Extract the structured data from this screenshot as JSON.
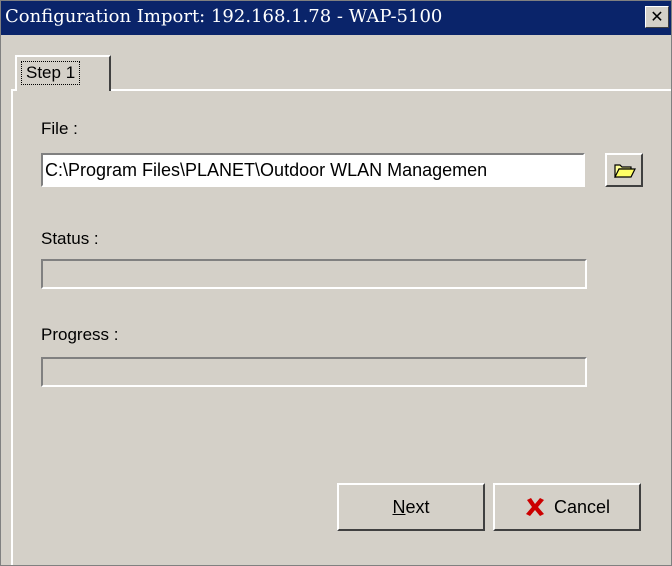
{
  "window": {
    "title": "Configuration Import: 192.168.1.78 - WAP-5100",
    "close_label": "✕"
  },
  "tabs": [
    {
      "label": "Step 1",
      "selected": true
    }
  ],
  "form": {
    "file_label": "File :",
    "file_value": "C:\\Program Files\\PLANET\\Outdoor WLAN Managemen",
    "status_label": "Status :",
    "status_value": "",
    "progress_label": "Progress :",
    "progress_value": 0
  },
  "buttons": {
    "next_label_rest": "ext",
    "next_label_mnemonic": "N",
    "cancel_label": "Cancel"
  },
  "icons": {
    "browse": "folder-open-icon",
    "cancel": "red-x-icon"
  },
  "colors": {
    "titlebar": "#0a246a",
    "face": "#d4d0c8",
    "cancel_x": "#cc0000"
  }
}
